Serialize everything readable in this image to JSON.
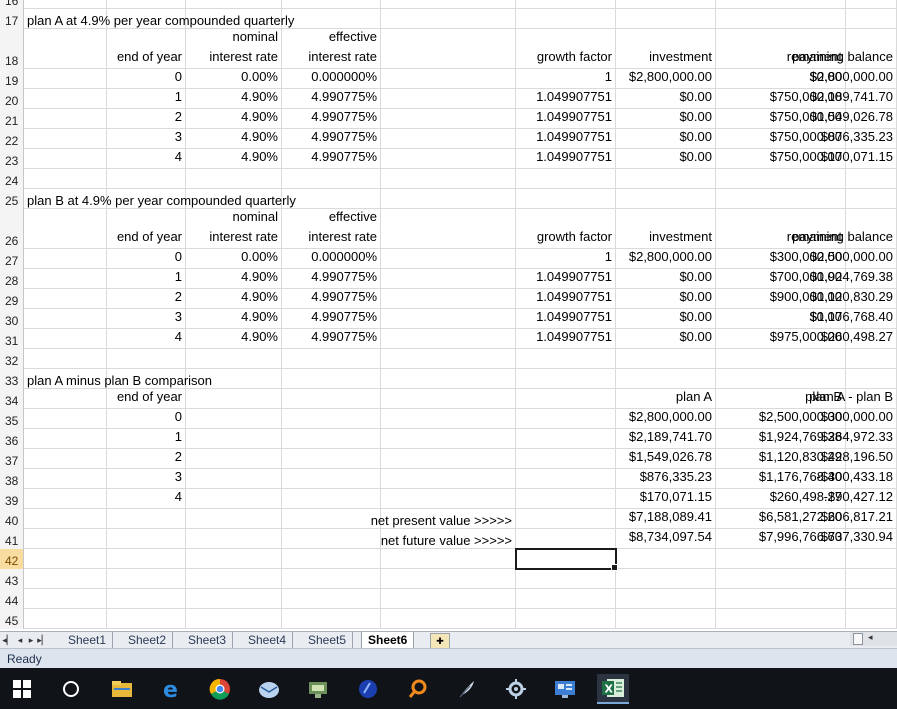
{
  "sheet": {
    "rows": [
      {
        "n": "16"
      },
      {
        "n": "17",
        "title": "plan A at 4.9% per year compounded quarterly"
      },
      {
        "n": "18",
        "cols": [
          "",
          "end of year",
          "nominal\ninterest rate",
          "effective\ninterest rate",
          "",
          "growth factor",
          "investment",
          "payment",
          "remaining balance"
        ],
        "tall": true
      },
      {
        "n": "19",
        "cols": [
          "",
          "0",
          "0.00%",
          "0.000000%",
          "",
          "1",
          "$2,800,000.00",
          "$0.00",
          "$2,800,000.00"
        ]
      },
      {
        "n": "20",
        "cols": [
          "",
          "1",
          "4.90%",
          "4.990775%",
          "",
          "1.049907751",
          "$0.00",
          "$750,000.00",
          "$2,189,741.70"
        ]
      },
      {
        "n": "21",
        "cols": [
          "",
          "2",
          "4.90%",
          "4.990775%",
          "",
          "1.049907751",
          "$0.00",
          "$750,000.00",
          "$1,549,026.78"
        ]
      },
      {
        "n": "22",
        "cols": [
          "",
          "3",
          "4.90%",
          "4.990775%",
          "",
          "1.049907751",
          "$0.00",
          "$750,000.00",
          "$876,335.23"
        ]
      },
      {
        "n": "23",
        "cols": [
          "",
          "4",
          "4.90%",
          "4.990775%",
          "",
          "1.049907751",
          "$0.00",
          "$750,000.00",
          "$170,071.15"
        ]
      },
      {
        "n": "24"
      },
      {
        "n": "25",
        "title": "plan B at 4.9% per year compounded quarterly"
      },
      {
        "n": "26",
        "cols": [
          "",
          "end of year",
          "nominal\ninterest rate",
          "effective\ninterest rate",
          "",
          "growth factor",
          "investment",
          "payment",
          "remaining balance"
        ],
        "tall": true
      },
      {
        "n": "27",
        "cols": [
          "",
          "0",
          "0.00%",
          "0.000000%",
          "",
          "1",
          "$2,800,000.00",
          "$300,000.00",
          "$2,500,000.00"
        ]
      },
      {
        "n": "28",
        "cols": [
          "",
          "1",
          "4.90%",
          "4.990775%",
          "",
          "1.049907751",
          "$0.00",
          "$700,000.00",
          "$1,924,769.38"
        ]
      },
      {
        "n": "29",
        "cols": [
          "",
          "2",
          "4.90%",
          "4.990775%",
          "",
          "1.049907751",
          "$0.00",
          "$900,000.00",
          "$1,120,830.29"
        ]
      },
      {
        "n": "30",
        "cols": [
          "",
          "3",
          "4.90%",
          "4.990775%",
          "",
          "1.049907751",
          "$0.00",
          "$0.00",
          "$1,176,768.40"
        ]
      },
      {
        "n": "31",
        "cols": [
          "",
          "4",
          "4.90%",
          "4.990775%",
          "",
          "1.049907751",
          "$0.00",
          "$975,000.00",
          "$260,498.27"
        ]
      },
      {
        "n": "32"
      },
      {
        "n": "33",
        "title": "plan A minus plan B comparison"
      },
      {
        "n": "34",
        "cols": [
          "",
          "end of year",
          "",
          "",
          "",
          "",
          "plan A",
          "plan B",
          "plan A - plan B"
        ]
      },
      {
        "n": "35",
        "cols": [
          "",
          "0",
          "",
          "",
          "",
          "",
          "$2,800,000.00",
          "$2,500,000.00",
          "$300,000.00"
        ]
      },
      {
        "n": "36",
        "cols": [
          "",
          "1",
          "",
          "",
          "",
          "",
          "$2,189,741.70",
          "$1,924,769.38",
          "$264,972.33"
        ]
      },
      {
        "n": "37",
        "cols": [
          "",
          "2",
          "",
          "",
          "",
          "",
          "$1,549,026.78",
          "$1,120,830.29",
          "$428,196.50"
        ]
      },
      {
        "n": "38",
        "cols": [
          "",
          "3",
          "",
          "",
          "",
          "",
          "$876,335.23",
          "$1,176,768.40",
          "-$300,433.18"
        ]
      },
      {
        "n": "39",
        "cols": [
          "",
          "4",
          "",
          "",
          "",
          "",
          "$170,071.15",
          "$260,498.27",
          "-$90,427.12"
        ]
      },
      {
        "n": "40",
        "label": "net present value >>>>>",
        "cols": [
          "",
          "",
          "",
          "",
          "",
          "",
          "$7,188,089.41",
          "$6,581,272.20",
          "$606,817.21"
        ]
      },
      {
        "n": "41",
        "label": "net future value >>>>>",
        "cols": [
          "",
          "",
          "",
          "",
          "",
          "",
          "$8,734,097.54",
          "$7,996,766.60",
          "$737,330.94"
        ]
      },
      {
        "n": "42",
        "selected": true
      },
      {
        "n": "43"
      },
      {
        "n": "44"
      },
      {
        "n": "45"
      }
    ]
  },
  "tabs": [
    "Sheet1",
    "Sheet2",
    "Sheet3",
    "Sheet4",
    "Sheet5",
    "Sheet6"
  ],
  "active_tab": "Sheet6",
  "status": "Ready",
  "taskbar": {
    "icons": [
      "windows-start-icon",
      "search-circle-icon",
      "file-explorer-icon",
      "edge-browser-icon",
      "chrome-icon",
      "mail-icon",
      "network-icon",
      "app-icon-blue-circle",
      "magnifier-icon",
      "feather-icon",
      "gear-tools-icon",
      "remote-desktop-icon",
      "excel-icon"
    ]
  }
}
